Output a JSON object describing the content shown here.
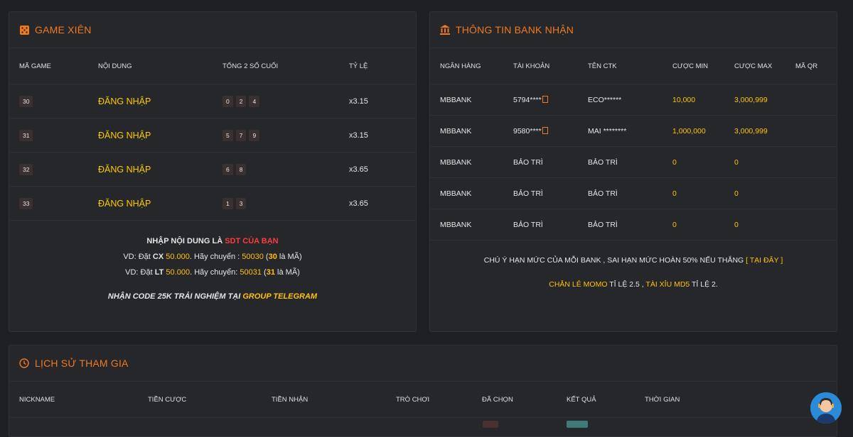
{
  "game_panel": {
    "title": "GAME XIÊN",
    "icon": "dice-icon",
    "columns": [
      "MÃ GAME",
      "NỘI DUNG",
      "TỔNG 2 SỐ CUỐI",
      "TỶ LỆ"
    ],
    "rows": [
      {
        "code": "30",
        "content": "ĐĂNG NHẬP",
        "numbers": [
          "0",
          "2",
          "4"
        ],
        "rate": "x3.15"
      },
      {
        "code": "31",
        "content": "ĐĂNG NHẬP",
        "numbers": [
          "5",
          "7",
          "9"
        ],
        "rate": "x3.15"
      },
      {
        "code": "32",
        "content": "ĐĂNG NHẬP",
        "numbers": [
          "6",
          "8"
        ],
        "rate": "x3.65"
      },
      {
        "code": "33",
        "content": "ĐĂNG NHẬP",
        "numbers": [
          "1",
          "3"
        ],
        "rate": "x3.65"
      }
    ],
    "note": {
      "line1_a": "NHẬP NỘI DUNG LÀ ",
      "line1_b": "SDT CỦA BẠN",
      "ex1": {
        "a": "VD: Đặt ",
        "b": "CX",
        "c": " ",
        "d": "50.000",
        "e": ". Hãy chuyển : ",
        "f": "50030",
        "g": " (",
        "h": "30",
        "i": " là MÃ)"
      },
      "ex2": {
        "a": "VD: Đặt ",
        "b": "LT",
        "c": " ",
        "d": "50.000",
        "e": ". Hãy chuyển: ",
        "f": "50031",
        "g": " (",
        "h": "31",
        "i": " là MÃ)"
      },
      "promo_a": "NHẬN CODE 25K TRẢI NGHIỆM TẠI ",
      "promo_b": "GROUP TELEGRAM"
    }
  },
  "bank_panel": {
    "title": "THÔNG TIN BANK NHẬN",
    "icon": "bank-icon",
    "columns": [
      "NGÂN HÀNG",
      "TÀI KHOẢN",
      "TÊN CTK",
      "CƯỢC MIN",
      "CƯỢC MAX",
      "MÃ QR"
    ],
    "rows": [
      {
        "bank": "MBBANK",
        "account": "5794****",
        "name": "ECO******",
        "min": "10,000",
        "max": "3,000,999"
      },
      {
        "bank": "MBBANK",
        "account": "9580****",
        "name": "MAI ********",
        "min": "1,000,000",
        "max": "3,000,999"
      },
      {
        "bank": "MBBANK",
        "account": "BẢO TRÌ",
        "name": "BẢO TRÌ",
        "min": "0",
        "max": "0"
      },
      {
        "bank": "MBBANK",
        "account": "BẢO TRÌ",
        "name": "BẢO TRÌ",
        "min": "0",
        "max": "0"
      },
      {
        "bank": "MBBANK",
        "account": "BẢO TRÌ",
        "name": "BẢO TRÌ",
        "min": "0",
        "max": "0"
      }
    ],
    "note1_a": "CHÚ Ý HẠN MỨC CỦA MỖI BANK , SAI HẠN MỨC HOÀN 50% NẾU THẮNG ",
    "note1_b": "[ TẠI ĐÂY ]",
    "note2_a": "CHẴN LẺ MOMO",
    "note2_b": " TỈ LỆ 2.5 , ",
    "note2_c": "TÀI XỈU MD5",
    "note2_d": " TỈ LỆ 2."
  },
  "history_panel": {
    "title": "LỊCH SỬ THAM GIA",
    "icon": "clock-icon",
    "columns": [
      "NICKNAME",
      "TIỀN CƯỢC",
      "TIỀN NHẬN",
      "TRÒ CHƠI",
      "ĐÃ CHỌN",
      "KẾT QUẢ",
      "THỜI GIAN"
    ]
  },
  "chatbot": {
    "icon": "support-agent-icon"
  },
  "colors": {
    "accent": "#f07a1f",
    "yellow": "#ffc107",
    "red": "#ff3b3b",
    "background": "#1e2023",
    "panel": "#25272b"
  }
}
